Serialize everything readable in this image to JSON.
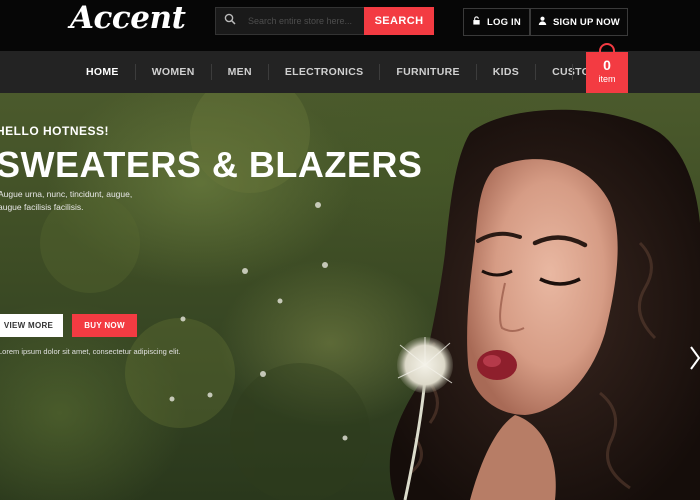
{
  "brand": {
    "logo": "Accent"
  },
  "search": {
    "placeholder": "Search entire store here...",
    "button": "SEARCH"
  },
  "account": {
    "login": "LOG IN",
    "signup": "SIGN UP NOW"
  },
  "nav": {
    "items": [
      "HOME",
      "WOMEN",
      "MEN",
      "ELECTRONICS",
      "FURNITURE",
      "KIDS",
      "CUSTOM"
    ],
    "active": "HOME"
  },
  "cart": {
    "count": "0",
    "label": "item"
  },
  "hero": {
    "eyebrow": "HELLO HOTNESS!",
    "title": "SWEATERS & BLAZERS",
    "text_line1": "Augue urna, nunc, tincidunt, augue,",
    "text_line2": "augue facilisis facilisis.",
    "view_button": "VIEW MORE",
    "buy_button": "BUY NOW",
    "caption": "Lorem ipsum dolor sit amet, consectetur adipiscing elit."
  },
  "colors": {
    "accent": "#f33b42",
    "topbar": "#060606",
    "navbar": "#232323"
  },
  "icons": [
    "search-icon",
    "lock-icon",
    "user-icon",
    "cart-icon",
    "chevron-right-icon"
  ]
}
